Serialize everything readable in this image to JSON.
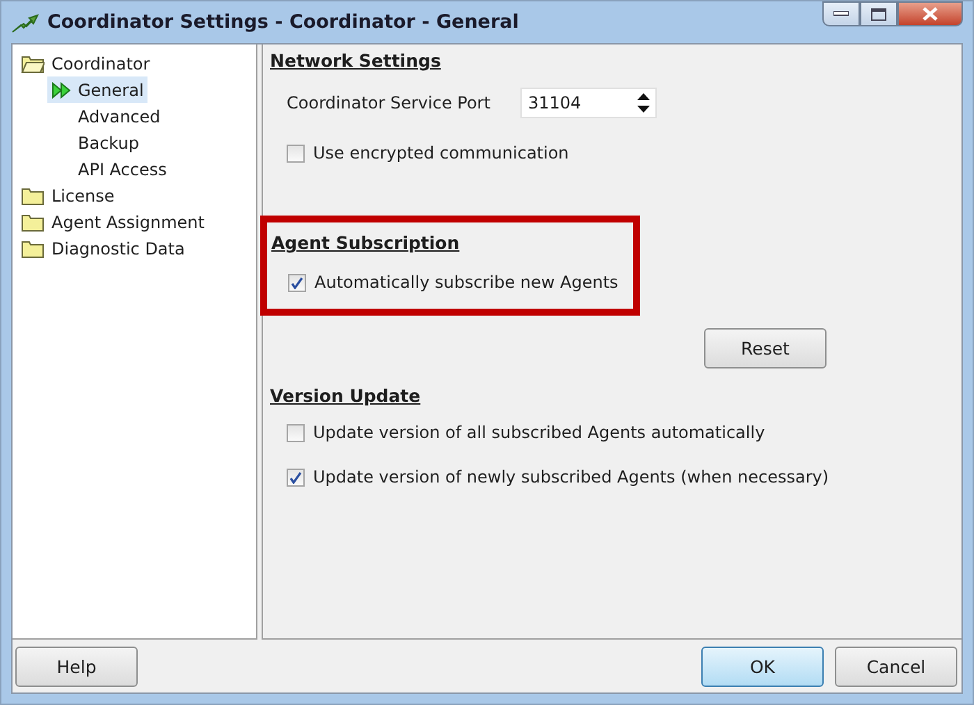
{
  "window": {
    "title": "Coordinator Settings - Coordinator - General"
  },
  "tree": [
    {
      "label": "Coordinator",
      "expanded": true,
      "selected": false,
      "children": [
        {
          "label": "General",
          "selected": true
        },
        {
          "label": "Advanced",
          "selected": false
        },
        {
          "label": "Backup",
          "selected": false
        },
        {
          "label": "API Access",
          "selected": false
        }
      ]
    },
    {
      "label": "License",
      "expanded": false,
      "selected": false
    },
    {
      "label": "Agent Assignment",
      "expanded": false,
      "selected": false
    },
    {
      "label": "Diagnostic Data",
      "expanded": false,
      "selected": false
    }
  ],
  "sections": [
    {
      "title": "Network Settings",
      "highlighted": false,
      "items": [
        {
          "kind": "spinner",
          "label": "Coordinator Service Port",
          "value": "31104"
        },
        {
          "kind": "checkbox",
          "label": "Use encrypted communication",
          "checked": false
        }
      ]
    },
    {
      "title": "Agent Subscription",
      "highlighted": true,
      "button": "Reset",
      "items": [
        {
          "kind": "checkbox",
          "label": "Automatically subscribe new Agents",
          "checked": true
        }
      ]
    },
    {
      "title": "Version Update",
      "highlighted": false,
      "items": [
        {
          "kind": "checkbox",
          "label": "Update version of all subscribed Agents automatically",
          "checked": false
        },
        {
          "kind": "checkbox",
          "label": "Update version of newly subscribed Agents (when necessary)",
          "checked": true
        }
      ]
    }
  ],
  "buttons": [
    {
      "label": "Help",
      "default": false
    },
    {
      "label": "OK",
      "default": true
    },
    {
      "label": "Cancel",
      "default": false
    }
  ]
}
